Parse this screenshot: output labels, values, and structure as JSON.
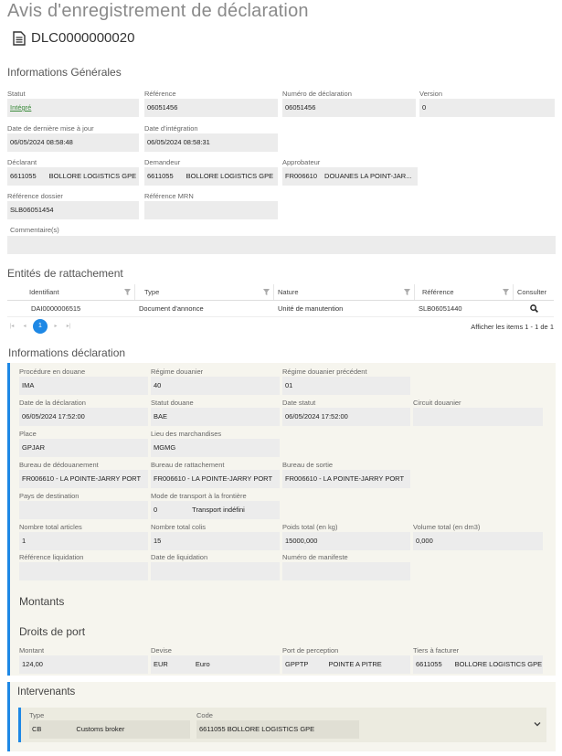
{
  "header": {
    "title": "Avis d'enregistrement de déclaration",
    "doc_id": "DLC0000000020"
  },
  "info_generales": {
    "title": "Informations Générales",
    "statut": {
      "label": "Statut",
      "value": "Intégré"
    },
    "reference": {
      "label": "Référence",
      "value": "06051456"
    },
    "num_declaration": {
      "label": "Numéro de déclaration",
      "value": "06051456"
    },
    "version": {
      "label": "Version",
      "value": "0"
    },
    "date_maj": {
      "label": "Date de dernière mise à jour",
      "value": "06/05/2024 08:58:48"
    },
    "date_integration": {
      "label": "Date d'intégration",
      "value": "06/05/2024 08:58:31"
    },
    "declarant": {
      "label": "Déclarant",
      "code": "6611055",
      "name": "BOLLORE LOGISTICS GPE"
    },
    "demandeur": {
      "label": "Demandeur",
      "code": "6611055",
      "name": "BOLLORE LOGISTICS GPE"
    },
    "approbateur": {
      "label": "Approbateur",
      "code": "FR006610",
      "name": "DOUANES LA POINT-JAR..."
    },
    "ref_dossier": {
      "label": "Référence dossier",
      "value": "SLB06051454"
    },
    "ref_mrn": {
      "label": "Référence MRN",
      "value": ""
    },
    "commentaires": {
      "label": "Commentaire(s)",
      "value": ""
    }
  },
  "entites": {
    "title": "Entités de rattachement",
    "columns": [
      "Identifiant",
      "Type",
      "Nature",
      "Référence",
      "Consulter"
    ],
    "rows": [
      [
        "DAI0000006515",
        "Document d'annonce",
        "Unité de manutention",
        "SLB06051440"
      ]
    ],
    "pager": {
      "current": "1",
      "info": "Afficher les items 1 - 1 de 1"
    }
  },
  "info_declaration": {
    "title": "Informations déclaration",
    "procedure": {
      "label": "Procédure en douane",
      "value": "IMA"
    },
    "regime": {
      "label": "Régime douanier",
      "value": "40"
    },
    "regime_prec": {
      "label": "Régime douanier précédent",
      "value": "01"
    },
    "date_decl": {
      "label": "Date de la déclaration",
      "value": "06/05/2024 17:52:00"
    },
    "statut_douane": {
      "label": "Statut douane",
      "value": "BAE"
    },
    "date_statut": {
      "label": "Date statut",
      "value": "06/05/2024 17:52:00"
    },
    "circuit": {
      "label": "Circuit douanier",
      "value": ""
    },
    "place": {
      "label": "Place",
      "value": "GPJAR"
    },
    "lieu_marchandises": {
      "label": "Lieu des marchandises",
      "value": "MGMG"
    },
    "bureau_dedouanement": {
      "label": "Bureau de dédouanement",
      "value": "FR006610  -  LA POINTE-JARRY PORT"
    },
    "bureau_rattachement": {
      "label": "Bureau de rattachement",
      "value": "FR006610  -  LA POINTE-JARRY PORT"
    },
    "bureau_sortie": {
      "label": "Bureau de sortie",
      "value": "FR006610  -  LA POINTE-JARRY PORT"
    },
    "pays_destination": {
      "label": "Pays de destination",
      "value": ""
    },
    "mode_transport": {
      "label": "Mode de transport à la frontière",
      "code": "0",
      "name": "Transport indéfini"
    },
    "nb_articles": {
      "label": "Nombre total articles",
      "value": "1"
    },
    "nb_colis": {
      "label": "Nombre total colis",
      "value": "15"
    },
    "poids": {
      "label": "Poids total (en kg)",
      "value": "15000,000"
    },
    "volume": {
      "label": "Volume total (en dm3)",
      "value": "0,000"
    },
    "ref_liquidation": {
      "label": "Référence liquidation",
      "value": ""
    },
    "date_liquidation": {
      "label": "Date de liquidation",
      "value": ""
    },
    "num_manifeste": {
      "label": "Numéro de manifeste",
      "value": ""
    },
    "montants_title": "Montants",
    "droits_title": "Droits de port",
    "montant": {
      "label": "Montant",
      "value": "124,00"
    },
    "devise": {
      "label": "Devise",
      "code": "EUR",
      "name": "Euro"
    },
    "port_perception": {
      "label": "Port de perception",
      "code": "GPPTP",
      "name": "POINTE A PITRE"
    },
    "tiers": {
      "label": "Tiers à facturer",
      "code": "6611055",
      "name": "BOLLORE LOGISTICS GPE"
    }
  },
  "intervenants": {
    "title": "Intervenants",
    "type": {
      "label": "Type",
      "code": "CB",
      "name": "Customs broker"
    },
    "code": {
      "label": "Code",
      "value": "6611055 BOLLORE LOGISTICS GPE"
    }
  },
  "colors": {
    "accent": "#1e88e5",
    "link": "#3a8a3a",
    "field_bg": "#ececec"
  }
}
